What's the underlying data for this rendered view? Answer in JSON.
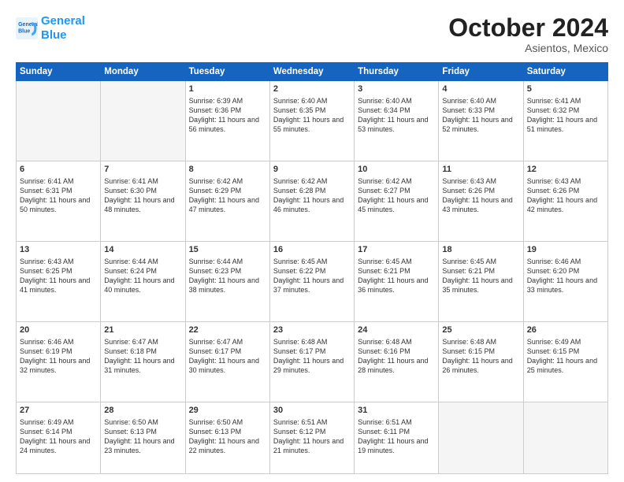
{
  "logo": {
    "line1": "General",
    "line2": "Blue"
  },
  "title": "October 2024",
  "subtitle": "Asientos, Mexico",
  "days_of_week": [
    "Sunday",
    "Monday",
    "Tuesday",
    "Wednesday",
    "Thursday",
    "Friday",
    "Saturday"
  ],
  "weeks": [
    [
      {
        "day": "",
        "empty": true
      },
      {
        "day": "",
        "empty": true
      },
      {
        "day": "1",
        "sunrise": "6:39 AM",
        "sunset": "6:36 PM",
        "daylight": "11 hours and 56 minutes."
      },
      {
        "day": "2",
        "sunrise": "6:40 AM",
        "sunset": "6:35 PM",
        "daylight": "11 hours and 55 minutes."
      },
      {
        "day": "3",
        "sunrise": "6:40 AM",
        "sunset": "6:34 PM",
        "daylight": "11 hours and 53 minutes."
      },
      {
        "day": "4",
        "sunrise": "6:40 AM",
        "sunset": "6:33 PM",
        "daylight": "11 hours and 52 minutes."
      },
      {
        "day": "5",
        "sunrise": "6:41 AM",
        "sunset": "6:32 PM",
        "daylight": "11 hours and 51 minutes."
      }
    ],
    [
      {
        "day": "6",
        "sunrise": "6:41 AM",
        "sunset": "6:31 PM",
        "daylight": "11 hours and 50 minutes."
      },
      {
        "day": "7",
        "sunrise": "6:41 AM",
        "sunset": "6:30 PM",
        "daylight": "11 hours and 48 minutes."
      },
      {
        "day": "8",
        "sunrise": "6:42 AM",
        "sunset": "6:29 PM",
        "daylight": "11 hours and 47 minutes."
      },
      {
        "day": "9",
        "sunrise": "6:42 AM",
        "sunset": "6:28 PM",
        "daylight": "11 hours and 46 minutes."
      },
      {
        "day": "10",
        "sunrise": "6:42 AM",
        "sunset": "6:27 PM",
        "daylight": "11 hours and 45 minutes."
      },
      {
        "day": "11",
        "sunrise": "6:43 AM",
        "sunset": "6:26 PM",
        "daylight": "11 hours and 43 minutes."
      },
      {
        "day": "12",
        "sunrise": "6:43 AM",
        "sunset": "6:26 PM",
        "daylight": "11 hours and 42 minutes."
      }
    ],
    [
      {
        "day": "13",
        "sunrise": "6:43 AM",
        "sunset": "6:25 PM",
        "daylight": "11 hours and 41 minutes."
      },
      {
        "day": "14",
        "sunrise": "6:44 AM",
        "sunset": "6:24 PM",
        "daylight": "11 hours and 40 minutes."
      },
      {
        "day": "15",
        "sunrise": "6:44 AM",
        "sunset": "6:23 PM",
        "daylight": "11 hours and 38 minutes."
      },
      {
        "day": "16",
        "sunrise": "6:45 AM",
        "sunset": "6:22 PM",
        "daylight": "11 hours and 37 minutes."
      },
      {
        "day": "17",
        "sunrise": "6:45 AM",
        "sunset": "6:21 PM",
        "daylight": "11 hours and 36 minutes."
      },
      {
        "day": "18",
        "sunrise": "6:45 AM",
        "sunset": "6:21 PM",
        "daylight": "11 hours and 35 minutes."
      },
      {
        "day": "19",
        "sunrise": "6:46 AM",
        "sunset": "6:20 PM",
        "daylight": "11 hours and 33 minutes."
      }
    ],
    [
      {
        "day": "20",
        "sunrise": "6:46 AM",
        "sunset": "6:19 PM",
        "daylight": "11 hours and 32 minutes."
      },
      {
        "day": "21",
        "sunrise": "6:47 AM",
        "sunset": "6:18 PM",
        "daylight": "11 hours and 31 minutes."
      },
      {
        "day": "22",
        "sunrise": "6:47 AM",
        "sunset": "6:17 PM",
        "daylight": "11 hours and 30 minutes."
      },
      {
        "day": "23",
        "sunrise": "6:48 AM",
        "sunset": "6:17 PM",
        "daylight": "11 hours and 29 minutes."
      },
      {
        "day": "24",
        "sunrise": "6:48 AM",
        "sunset": "6:16 PM",
        "daylight": "11 hours and 28 minutes."
      },
      {
        "day": "25",
        "sunrise": "6:48 AM",
        "sunset": "6:15 PM",
        "daylight": "11 hours and 26 minutes."
      },
      {
        "day": "26",
        "sunrise": "6:49 AM",
        "sunset": "6:15 PM",
        "daylight": "11 hours and 25 minutes."
      }
    ],
    [
      {
        "day": "27",
        "sunrise": "6:49 AM",
        "sunset": "6:14 PM",
        "daylight": "11 hours and 24 minutes."
      },
      {
        "day": "28",
        "sunrise": "6:50 AM",
        "sunset": "6:13 PM",
        "daylight": "11 hours and 23 minutes."
      },
      {
        "day": "29",
        "sunrise": "6:50 AM",
        "sunset": "6:13 PM",
        "daylight": "11 hours and 22 minutes."
      },
      {
        "day": "30",
        "sunrise": "6:51 AM",
        "sunset": "6:12 PM",
        "daylight": "11 hours and 21 minutes."
      },
      {
        "day": "31",
        "sunrise": "6:51 AM",
        "sunset": "6:11 PM",
        "daylight": "11 hours and 19 minutes."
      },
      {
        "day": "",
        "empty": true
      },
      {
        "day": "",
        "empty": true
      }
    ]
  ],
  "labels": {
    "sunrise": "Sunrise:",
    "sunset": "Sunset:",
    "daylight": "Daylight:"
  }
}
